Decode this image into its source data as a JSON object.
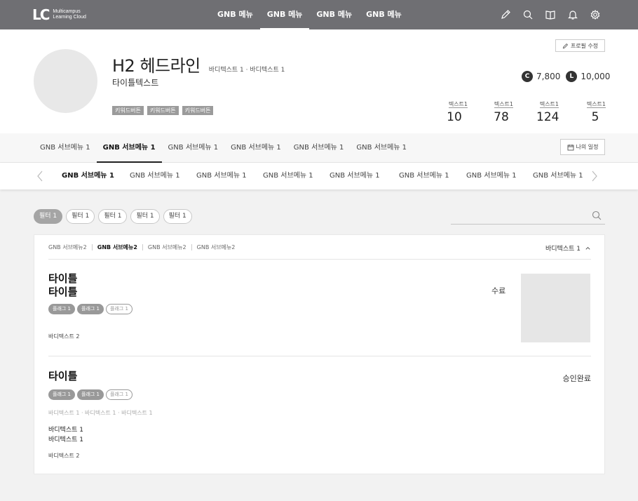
{
  "gnb": {
    "logo_mark": "LC",
    "logo_line1": "Multicampus",
    "logo_line2": "Learning Cloud",
    "menu": [
      "GNB 메뉴",
      "GNB 메뉴",
      "GNB 메뉴",
      "GNB 메뉴"
    ],
    "active_menu_index": 1,
    "icons": [
      "pencil-icon",
      "search-icon",
      "book-icon",
      "bell-icon",
      "gear-icon"
    ]
  },
  "profile": {
    "headline": "H2 헤드라인",
    "headline_sub": "바디텍스트 1 · 바디텍스트 1",
    "title_text": "타이틀텍스트",
    "keywords": [
      "키워드버튼",
      "키워드버튼",
      "키워드버튼"
    ],
    "edit_label": "프로필 수정",
    "points": [
      {
        "badge": "C",
        "value": "7,800"
      },
      {
        "badge": "L",
        "value": "10,000"
      }
    ],
    "stats": [
      {
        "label": "텍스트1",
        "value": "10"
      },
      {
        "label": "텍스트1",
        "value": "78"
      },
      {
        "label": "텍스트1",
        "value": "124"
      },
      {
        "label": "텍스트1",
        "value": "5"
      }
    ]
  },
  "submenu1": {
    "items": [
      "GNB 서브메뉴 1",
      "GNB 서브메뉴 1",
      "GNB 서브메뉴 1",
      "GNB 서브메뉴 1",
      "GNB 서브메뉴 1",
      "GNB 서브메뉴 1"
    ],
    "active_index": 1,
    "schedule_label": "나의 일정"
  },
  "submenu2": {
    "items": [
      "GNB 서브메뉴 1",
      "GNB 서브메뉴 1",
      "GNB 서브메뉴 1",
      "GNB 서브메뉴 1",
      "GNB 서브메뉴 1",
      "GNB 서브메뉴 1",
      "GNB 서브메뉴 1",
      "GNB 서브메뉴 1"
    ],
    "active_index": 0
  },
  "filters": {
    "chips": [
      "필터 1",
      "필터 1",
      "필터 1",
      "필터 1",
      "필터 1"
    ],
    "active_index": 0,
    "search_placeholder": ""
  },
  "list": {
    "tabs": [
      "GNB 서브메뉴2",
      "GNB 서브메뉴2",
      "GNB 서브메뉴2",
      "GNB 서브메뉴2"
    ],
    "active_tab_index": 1,
    "sort_label": "바디텍스트 1",
    "item1": {
      "title_line1": "타이틀",
      "title_line2": "타이틀",
      "tags": [
        "플래그 1",
        "플래그 1",
        "플래그 1"
      ],
      "status": "수료",
      "body2": "바디텍스트 2"
    },
    "item2": {
      "title": "타이틀",
      "tags": [
        "플래그 1",
        "플래그 1",
        "플래그 1"
      ],
      "status": "승인완료",
      "meta": "바디텍스트 1 · 바디텍스트 1 · 바디텍스트 1",
      "body1_line1": "바디텍스트 1",
      "body1_line2": "바디텍스트 1",
      "body2": "바디텍스트 2"
    }
  }
}
